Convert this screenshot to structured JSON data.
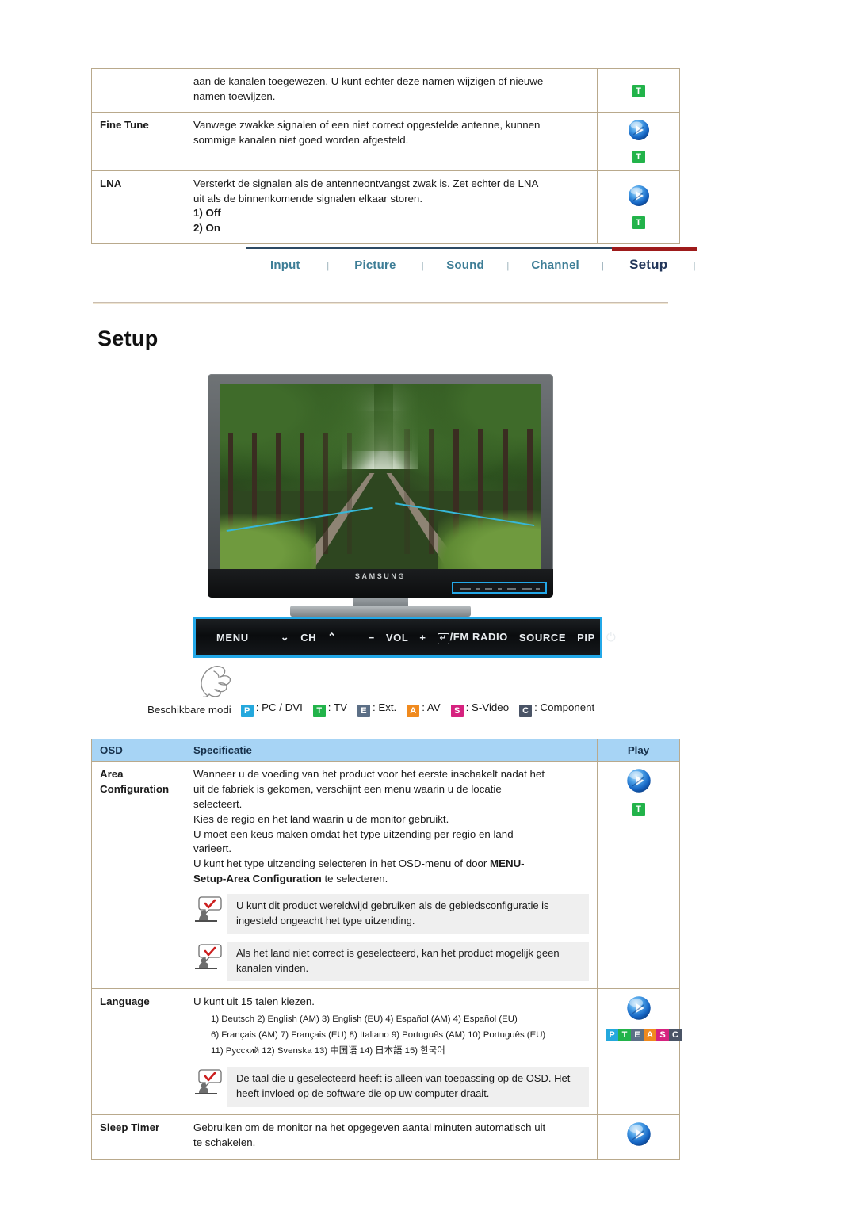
{
  "top_table": {
    "rows": [
      {
        "osd": "",
        "spec_lines": [
          "aan de kanalen toegewezen. U kunt echter deze namen wijzigen of nieuwe",
          "namen toewijzen."
        ],
        "play_badges": [
          "T"
        ]
      },
      {
        "osd": "Fine Tune",
        "spec_lines": [
          "Vanwege zwakke signalen of een niet correct opgestelde antenne, kunnen",
          "sommige kanalen niet goed worden afgesteld."
        ],
        "play_orb": true,
        "play_badges": [
          "T"
        ]
      },
      {
        "osd": "LNA",
        "spec_lines": [
          "Versterkt de signalen als de antenneontvangst zwak is. Zet echter de LNA",
          "uit als de binnenkomende signalen elkaar storen."
        ],
        "options": [
          "1) Off",
          "2) On"
        ],
        "play_orb": true,
        "play_badges": [
          "T"
        ]
      }
    ]
  },
  "nav": {
    "items": [
      {
        "label": "Input",
        "active": false
      },
      {
        "label": "Picture",
        "active": false
      },
      {
        "label": "Sound",
        "active": false
      },
      {
        "label": "Channel",
        "active": false
      },
      {
        "label": "Setup",
        "active": true
      }
    ],
    "separator": "|",
    "active_color": "#9e1b1b",
    "link_color": "#3d7d96",
    "active_text_color": "#22365a"
  },
  "page_title": "Setup",
  "monitor": {
    "brand": "SAMSUNG",
    "highlight_color": "#23a8e8",
    "controls": [
      {
        "label": "MENU",
        "icon": "menu-label"
      },
      {
        "label": "⌄",
        "icon": "chevron-down-icon"
      },
      {
        "label": "CH",
        "icon": "channel-label"
      },
      {
        "label": "⌃",
        "icon": "chevron-up-icon"
      },
      {
        "label": "−",
        "icon": "minus-icon"
      },
      {
        "label": "VOL",
        "icon": "volume-label"
      },
      {
        "label": "+",
        "icon": "plus-icon"
      },
      {
        "label": "/FM RADIO",
        "icon": "enter-icon"
      },
      {
        "label": "SOURCE",
        "icon": "source-label"
      },
      {
        "label": "PIP",
        "icon": "pip-label"
      },
      {
        "label": "⏻",
        "icon": "power-icon"
      }
    ],
    "enter_glyph": "↵"
  },
  "modes": {
    "label": "Beschikbare modi",
    "items": [
      {
        "badge": "P",
        "text": ": PC / DVI",
        "color": "#24a8dd"
      },
      {
        "badge": "T",
        "text": ": TV",
        "color": "#22b34a"
      },
      {
        "badge": "E",
        "text": ": Ext.",
        "color": "#5c6f86"
      },
      {
        "badge": "A",
        "text": ": AV",
        "color": "#f08a1e"
      },
      {
        "badge": "S",
        "text": ": S-Video",
        "color": "#d6227f"
      },
      {
        "badge": "C",
        "text": ": Component",
        "color": "#4a5466"
      }
    ]
  },
  "main_table": {
    "headers": {
      "osd": "OSD",
      "spec": "Specificatie",
      "play": "Play"
    },
    "rows": [
      {
        "osd": "Area Configuration",
        "osd_lines": [
          "Area",
          "Configuration"
        ],
        "spec_lines": [
          "Wanneer u de voeding van het product voor het eerste inschakelt nadat het",
          "uit de fabriek is gekomen, verschijnt een menu waarin u de locatie",
          "selecteert.",
          "Kies de regio en het land waarin u de monitor gebruikt.",
          "U moet een keus maken omdat het type uitzending per regio en land",
          "varieert."
        ],
        "spec_last_pre": "U kunt het type uitzending selecteren in het OSD-menu of door ",
        "spec_last_bold1": "MENU-",
        "spec_last_bold2": "Setup-Area Configuration",
        "spec_last_post": " te selecteren.",
        "notes": [
          "U kunt dit product wereldwijd gebruiken als de gebiedsconfiguratie is ingesteld ongeacht het type uitzending.",
          "Als het land niet correct is geselecteerd, kan het product mogelijk geen kanalen vinden."
        ],
        "play_orb": true,
        "play_badges": [
          "T"
        ]
      },
      {
        "osd": "Language",
        "osd_lines": [
          "Language"
        ],
        "spec_lines": [
          "U kunt uit 15 talen kiezen."
        ],
        "language_lines": [
          "1)  Deutsch 2) English (AM)   3) English (EU) 4) Español (AM) 4) Español (EU)",
          "6) Français (AM) 7) Français (EU) 8) Italiano 9) Português (AM) 10) Português (EU)",
          "11) Русский 12) Svenska 13) 中国语 14) 日本語 15) 한국어"
        ],
        "notes": [
          "De taal die u geselecteerd heeft is alleen van toepassing op de OSD. Het heeft invloed op de software die op uw computer draait."
        ],
        "play_orb": true,
        "play_badges": [
          "P",
          "T",
          "E",
          "A",
          "S",
          "C"
        ]
      },
      {
        "osd": "Sleep Timer",
        "osd_lines": [
          "Sleep Timer"
        ],
        "spec_lines": [
          "Gebruiken om de monitor na het opgegeven aantal minuten automatisch uit",
          "te schakelen."
        ],
        "play_orb": true,
        "play_badges": []
      }
    ]
  },
  "colors": {
    "table_border": "#b9a98c",
    "header_bg": "#a7d4f5",
    "note_bg": "#efefef",
    "rule": "#c9bdb0"
  }
}
